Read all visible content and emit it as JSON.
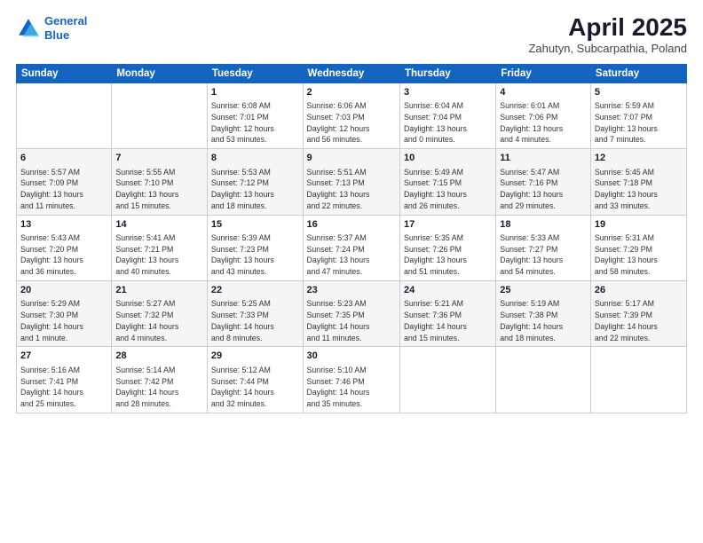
{
  "logo": {
    "line1": "General",
    "line2": "Blue"
  },
  "title": "April 2025",
  "subtitle": "Zahutyn, Subcarpathia, Poland",
  "weekdays": [
    "Sunday",
    "Monday",
    "Tuesday",
    "Wednesday",
    "Thursday",
    "Friday",
    "Saturday"
  ],
  "weeks": [
    [
      {
        "day": "",
        "detail": ""
      },
      {
        "day": "",
        "detail": ""
      },
      {
        "day": "1",
        "detail": "Sunrise: 6:08 AM\nSunset: 7:01 PM\nDaylight: 12 hours\nand 53 minutes."
      },
      {
        "day": "2",
        "detail": "Sunrise: 6:06 AM\nSunset: 7:03 PM\nDaylight: 12 hours\nand 56 minutes."
      },
      {
        "day": "3",
        "detail": "Sunrise: 6:04 AM\nSunset: 7:04 PM\nDaylight: 13 hours\nand 0 minutes."
      },
      {
        "day": "4",
        "detail": "Sunrise: 6:01 AM\nSunset: 7:06 PM\nDaylight: 13 hours\nand 4 minutes."
      },
      {
        "day": "5",
        "detail": "Sunrise: 5:59 AM\nSunset: 7:07 PM\nDaylight: 13 hours\nand 7 minutes."
      }
    ],
    [
      {
        "day": "6",
        "detail": "Sunrise: 5:57 AM\nSunset: 7:09 PM\nDaylight: 13 hours\nand 11 minutes."
      },
      {
        "day": "7",
        "detail": "Sunrise: 5:55 AM\nSunset: 7:10 PM\nDaylight: 13 hours\nand 15 minutes."
      },
      {
        "day": "8",
        "detail": "Sunrise: 5:53 AM\nSunset: 7:12 PM\nDaylight: 13 hours\nand 18 minutes."
      },
      {
        "day": "9",
        "detail": "Sunrise: 5:51 AM\nSunset: 7:13 PM\nDaylight: 13 hours\nand 22 minutes."
      },
      {
        "day": "10",
        "detail": "Sunrise: 5:49 AM\nSunset: 7:15 PM\nDaylight: 13 hours\nand 26 minutes."
      },
      {
        "day": "11",
        "detail": "Sunrise: 5:47 AM\nSunset: 7:16 PM\nDaylight: 13 hours\nand 29 minutes."
      },
      {
        "day": "12",
        "detail": "Sunrise: 5:45 AM\nSunset: 7:18 PM\nDaylight: 13 hours\nand 33 minutes."
      }
    ],
    [
      {
        "day": "13",
        "detail": "Sunrise: 5:43 AM\nSunset: 7:20 PM\nDaylight: 13 hours\nand 36 minutes."
      },
      {
        "day": "14",
        "detail": "Sunrise: 5:41 AM\nSunset: 7:21 PM\nDaylight: 13 hours\nand 40 minutes."
      },
      {
        "day": "15",
        "detail": "Sunrise: 5:39 AM\nSunset: 7:23 PM\nDaylight: 13 hours\nand 43 minutes."
      },
      {
        "day": "16",
        "detail": "Sunrise: 5:37 AM\nSunset: 7:24 PM\nDaylight: 13 hours\nand 47 minutes."
      },
      {
        "day": "17",
        "detail": "Sunrise: 5:35 AM\nSunset: 7:26 PM\nDaylight: 13 hours\nand 51 minutes."
      },
      {
        "day": "18",
        "detail": "Sunrise: 5:33 AM\nSunset: 7:27 PM\nDaylight: 13 hours\nand 54 minutes."
      },
      {
        "day": "19",
        "detail": "Sunrise: 5:31 AM\nSunset: 7:29 PM\nDaylight: 13 hours\nand 58 minutes."
      }
    ],
    [
      {
        "day": "20",
        "detail": "Sunrise: 5:29 AM\nSunset: 7:30 PM\nDaylight: 14 hours\nand 1 minute."
      },
      {
        "day": "21",
        "detail": "Sunrise: 5:27 AM\nSunset: 7:32 PM\nDaylight: 14 hours\nand 4 minutes."
      },
      {
        "day": "22",
        "detail": "Sunrise: 5:25 AM\nSunset: 7:33 PM\nDaylight: 14 hours\nand 8 minutes."
      },
      {
        "day": "23",
        "detail": "Sunrise: 5:23 AM\nSunset: 7:35 PM\nDaylight: 14 hours\nand 11 minutes."
      },
      {
        "day": "24",
        "detail": "Sunrise: 5:21 AM\nSunset: 7:36 PM\nDaylight: 14 hours\nand 15 minutes."
      },
      {
        "day": "25",
        "detail": "Sunrise: 5:19 AM\nSunset: 7:38 PM\nDaylight: 14 hours\nand 18 minutes."
      },
      {
        "day": "26",
        "detail": "Sunrise: 5:17 AM\nSunset: 7:39 PM\nDaylight: 14 hours\nand 22 minutes."
      }
    ],
    [
      {
        "day": "27",
        "detail": "Sunrise: 5:16 AM\nSunset: 7:41 PM\nDaylight: 14 hours\nand 25 minutes."
      },
      {
        "day": "28",
        "detail": "Sunrise: 5:14 AM\nSunset: 7:42 PM\nDaylight: 14 hours\nand 28 minutes."
      },
      {
        "day": "29",
        "detail": "Sunrise: 5:12 AM\nSunset: 7:44 PM\nDaylight: 14 hours\nand 32 minutes."
      },
      {
        "day": "30",
        "detail": "Sunrise: 5:10 AM\nSunset: 7:46 PM\nDaylight: 14 hours\nand 35 minutes."
      },
      {
        "day": "",
        "detail": ""
      },
      {
        "day": "",
        "detail": ""
      },
      {
        "day": "",
        "detail": ""
      }
    ]
  ]
}
